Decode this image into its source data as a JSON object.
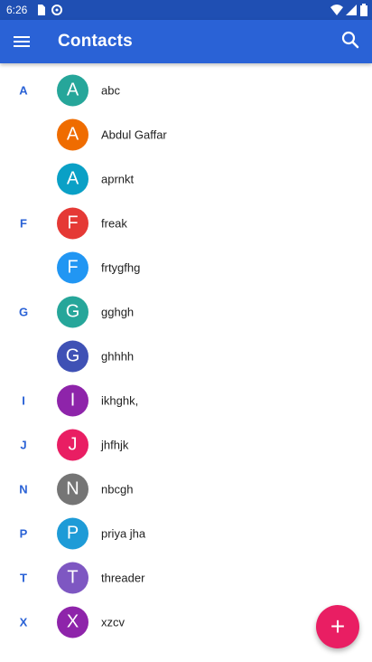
{
  "status_bar": {
    "time": "6:26"
  },
  "app_bar": {
    "title": "Contacts",
    "menu_icon": "hamburger-menu-icon",
    "search_icon": "search-icon"
  },
  "contacts": [
    {
      "section": "A",
      "initial": "A",
      "name": "abc",
      "color": "#26a69a"
    },
    {
      "section": "",
      "initial": "A",
      "name": "Abdul Gaffar",
      "color": "#ef6c00"
    },
    {
      "section": "",
      "initial": "A",
      "name": "aprnkt",
      "color": "#0aa0c6"
    },
    {
      "section": "F",
      "initial": "F",
      "name": "freak",
      "color": "#e53935"
    },
    {
      "section": "",
      "initial": "F",
      "name": "frtygfhg",
      "color": "#2196f3"
    },
    {
      "section": "G",
      "initial": "G",
      "name": "gghgh",
      "color": "#26a69a"
    },
    {
      "section": "",
      "initial": "G",
      "name": "ghhhh",
      "color": "#3f51b5"
    },
    {
      "section": "I",
      "initial": "I",
      "name": "ikhghk,",
      "color": "#8e24aa"
    },
    {
      "section": "J",
      "initial": "J",
      "name": "jhfhjk",
      "color": "#e91e63"
    },
    {
      "section": "N",
      "initial": "N",
      "name": "nbcgh",
      "color": "#757575"
    },
    {
      "section": "P",
      "initial": "P",
      "name": "priya jha",
      "color": "#1e9bd7"
    },
    {
      "section": "T",
      "initial": "T",
      "name": "threader",
      "color": "#7e57c2"
    },
    {
      "section": "X",
      "initial": "X",
      "name": "xzcv",
      "color": "#8e24aa"
    }
  ],
  "fab": {
    "icon": "add-icon",
    "label": "+",
    "color": "#e91e63"
  }
}
